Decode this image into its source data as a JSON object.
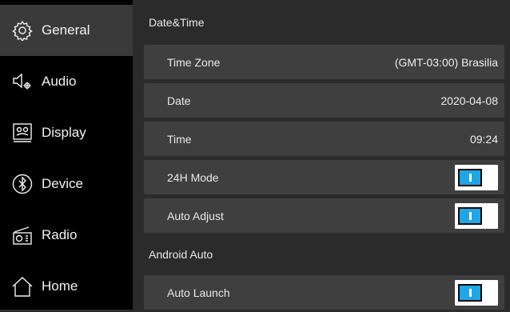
{
  "sidebar": {
    "items": [
      {
        "label": "General",
        "icon": "gear-icon",
        "active": true
      },
      {
        "label": "Audio",
        "icon": "speaker-settings-icon",
        "active": false
      },
      {
        "label": "Display",
        "icon": "display-icon",
        "active": false
      },
      {
        "label": "Device",
        "icon": "bluetooth-icon",
        "active": false
      },
      {
        "label": "Radio",
        "icon": "radio-icon",
        "active": false
      },
      {
        "label": "Home",
        "icon": "home-icon",
        "active": false
      }
    ]
  },
  "main": {
    "datetime_section": {
      "title": "Date&Time",
      "rows": [
        {
          "label": "Time Zone",
          "value": "(GMT-03:00) Brasilia"
        },
        {
          "label": "Date",
          "value": "2020-04-08"
        },
        {
          "label": "Time",
          "value": "09:24"
        },
        {
          "label": "24H Mode",
          "toggle": true
        },
        {
          "label": "Auto Adjust",
          "toggle": true
        }
      ]
    },
    "android_section": {
      "title": "Android Auto",
      "rows": [
        {
          "label": "Auto Launch",
          "toggle": true
        }
      ]
    }
  },
  "colors": {
    "toggle_on": "#1fa6e6",
    "sidebar_bg": "#000000",
    "row_bg": "#3f3f3f"
  }
}
